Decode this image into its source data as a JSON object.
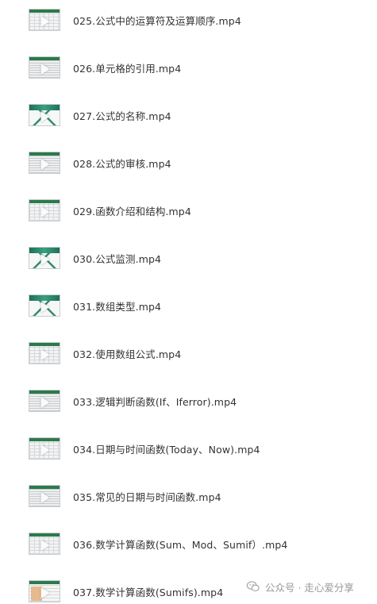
{
  "files": [
    {
      "name": "025.公式中的运算符及运算顺序.mp4",
      "thumb": "grid-icon"
    },
    {
      "name": "026.单元格的引用.mp4",
      "thumb": "grid-icon"
    },
    {
      "name": "027.公式的名称.mp4",
      "thumb": "title-slide-icon"
    },
    {
      "name": "028.公式的审核.mp4",
      "thumb": "grid-icon"
    },
    {
      "name": "029.函数介绍和结构.mp4",
      "thumb": "sheet-icon"
    },
    {
      "name": "030.公式监测.mp4",
      "thumb": "title-slide-icon"
    },
    {
      "name": "031.数组类型.mp4",
      "thumb": "title-slide-icon"
    },
    {
      "name": "032.使用数组公式.mp4",
      "thumb": "sheet-icon"
    },
    {
      "name": "033.逻辑判断函数(If、Iferror).mp4",
      "thumb": "sheet-icon"
    },
    {
      "name": "034.日期与时间函数(Today、Now).mp4",
      "thumb": "sheet-icon"
    },
    {
      "name": "035.常见的日期与时间函数.mp4",
      "thumb": "grid-icon"
    },
    {
      "name": "036.数学计算函数(Sum、Mod、Sumif）.mp4",
      "thumb": "sheet-icon"
    },
    {
      "name": "037.数学计算函数(Sumifs).mp4",
      "thumb": "photo-sheet-icon"
    }
  ],
  "watermark": {
    "text": "公众号 · 走心爱分享",
    "icon": "wechat-icon",
    "color": "#999999"
  },
  "colors": {
    "text": "#333333",
    "thumb_accent": "#2b7a4b",
    "background": "#ffffff"
  }
}
